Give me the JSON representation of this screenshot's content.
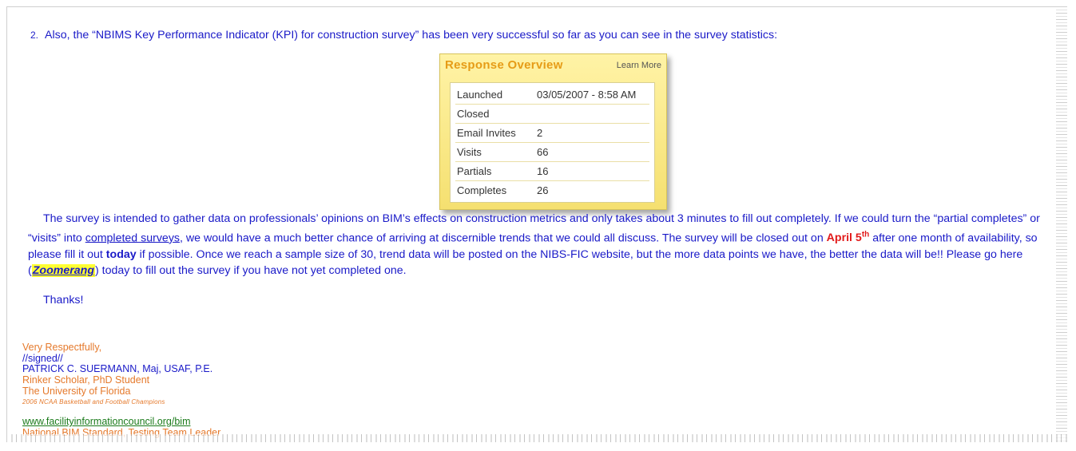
{
  "item2": {
    "number": "2.",
    "text": "Also, the “NBIMS Key Performance Indicator (KPI)  for construction survey” has been very successful so far as you can see in the survey statistics:"
  },
  "widget": {
    "title": "Response Overview",
    "link": "Learn More",
    "rows": [
      {
        "label": "Launched",
        "value": "03/05/2007 - 8:58 AM"
      },
      {
        "label": "Closed",
        "value": ""
      },
      {
        "label": "Email Invites",
        "value": "2"
      },
      {
        "label": "Visits",
        "value": "66"
      },
      {
        "label": "Partials",
        "value": "16"
      },
      {
        "label": "Completes",
        "value": "26"
      }
    ]
  },
  "paragraph": {
    "s1": "The survey is intended to gather data on professionals’ opinions on BIM’s effects on construction metrics and only takes about 3 minutes to fill out completely.  If we could turn the “partial completes” or “visits” into ",
    "s2_link": "completed surveys",
    "s3": ", we would have a much better chance of arriving at discernible trends that we could all discuss.  The survey will be closed out on ",
    "date_main": "April 5",
    "date_sup": "th",
    "s4": " after one month of availability, so please fill it out ",
    "today": "today",
    "s5": " if possible.  Once we reach a sample size of 30, trend data will be posted on the NIBS-FIC website, but the more data points we have, the better the data will be!!  Please go here (",
    "zoom": "Zoomerang",
    "s6": ") today to fill out the survey if you have not yet completed one."
  },
  "thanks": "Thanks!",
  "signature": {
    "closing": "Very Respectfully,",
    "signed": "//signed//",
    "name": "PATRICK C. SUERMANN, Maj, USAF, P.E.",
    "title": "Rinker Scholar, PhD Student",
    "university": "The University of Florida",
    "champions": "2006 NCAA Basketball and Football Champions",
    "website": "www.facilityinformationcouncil.org/bim",
    "role": "National BIM Standard, Testing Team Leader"
  },
  "colors": {
    "body_text": "#1a1ac8",
    "signature_orange": "#e5792b",
    "highlight_red": "#e21a1a",
    "link_green": "#1a7a1a",
    "widget_yellow": "#f5e070"
  }
}
